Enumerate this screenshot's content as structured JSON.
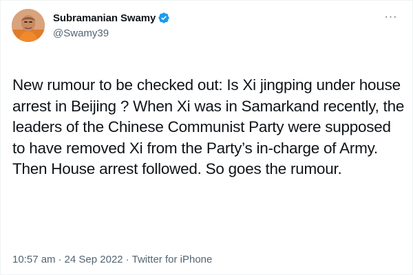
{
  "tweet": {
    "author": {
      "display_name": "Subramanian Swamy",
      "handle": "@Swamy39",
      "verified": true,
      "avatar_icon": "profile-photo",
      "verified_icon": "verified-badge-icon"
    },
    "more_icon": "more-options-icon",
    "more_glyph": "···",
    "text": "New rumour to be checked out: Is Xi jingping under house arrest in Beijing ? When Xi was in Samarkand recently, the leaders of the Chinese Communist Party were supposed to have removed Xi from the Party’s in-charge of Army. Then House arrest followed. So goes the rumour.",
    "time": "10:57 am",
    "separator": "·",
    "date": "24 Sep 2022",
    "source": "Twitter for iPhone"
  },
  "colors": {
    "text_primary": "#0f1419",
    "text_secondary": "#536471",
    "verified_blue": "#1d9bf0",
    "border": "#eff3f4"
  }
}
